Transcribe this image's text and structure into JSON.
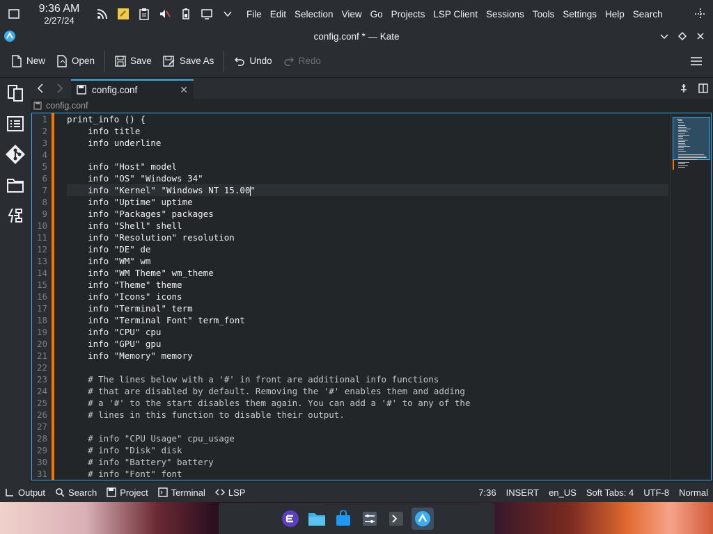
{
  "panel": {
    "time": "9:36 AM",
    "date": "2/27/24",
    "tray_icons": [
      "rss-icon",
      "notes-icon",
      "clipboard-icon",
      "volume-muted-icon",
      "battery-icon",
      "display-icon",
      "chevron-down-icon"
    ]
  },
  "menu": {
    "items": [
      "File",
      "Edit",
      "Selection",
      "View",
      "Go",
      "Projects",
      "LSP Client",
      "Sessions",
      "Tools",
      "Settings",
      "Help",
      "Search"
    ]
  },
  "window": {
    "title": "config.conf * — Kate"
  },
  "toolbar": {
    "new_label": "New",
    "open_label": "Open",
    "save_label": "Save",
    "save_as_label": "Save As",
    "undo_label": "Undo",
    "redo_label": "Redo"
  },
  "tabs": [
    {
      "label": "config.conf",
      "active": true
    }
  ],
  "breadcrumb": {
    "file": "config.conf"
  },
  "editor": {
    "current_line": 7,
    "lines": [
      "print_info () {",
      "    info title",
      "    info underline",
      "",
      "    info \"Host\" model",
      "    info \"OS\" \"Windows 34\"",
      "    info \"Kernel\" \"Windows NT 15.00\"",
      "    info \"Uptime\" uptime",
      "    info \"Packages\" packages",
      "    info \"Shell\" shell",
      "    info \"Resolution\" resolution",
      "    info \"DE\" de",
      "    info \"WM\" wm",
      "    info \"WM Theme\" wm_theme",
      "    info \"Theme\" theme",
      "    info \"Icons\" icons",
      "    info \"Terminal\" term",
      "    info \"Terminal Font\" term_font",
      "    info \"CPU\" cpu",
      "    info \"GPU\" gpu",
      "    info \"Memory\" memory",
      "",
      "    # The lines below with a '#' in front are additional info functions",
      "    # that are disabled by default. Removing the '#' enables them and adding",
      "    # a '#' to the start disables them again. You can add a '#' to any of the",
      "    # lines in this function to disable their output.",
      "",
      "    # info \"CPU Usage\" cpu_usage",
      "    # info \"Disk\" disk",
      "    # info \"Battery\" battery",
      "    # info \"Font\" font"
    ]
  },
  "statusbar": {
    "output_label": "Output",
    "search_label": "Search",
    "project_label": "Project",
    "terminal_label": "Terminal",
    "lsp_label": "LSP",
    "cursor_pos": "7:36",
    "mode": "INSERT",
    "language": "en_US",
    "indent": "Soft Tabs: 4",
    "encoding": "UTF-8",
    "highlight": "Normal"
  },
  "dock": {
    "apps": [
      "app-launcher-icon",
      "file-manager-icon",
      "store-icon",
      "system-settings-icon",
      "terminal-icon",
      "kate-icon"
    ]
  },
  "colors": {
    "accent": "#3daee9",
    "modified": "#f67400",
    "background": "#232629",
    "panel": "#2a2e32"
  }
}
